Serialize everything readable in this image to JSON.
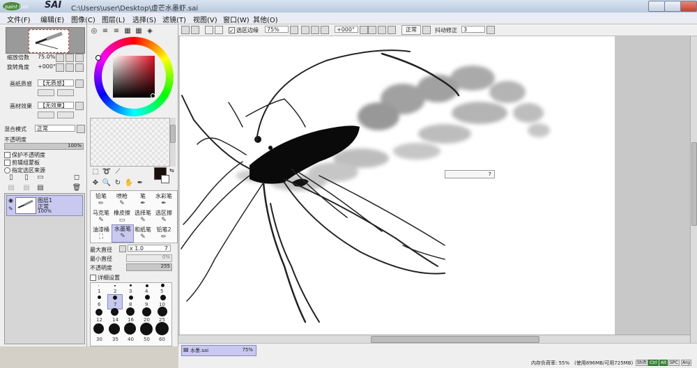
{
  "window": {
    "app_name": "SAI",
    "title": "C:\\Users\\user\\Desktop\\虚芒水墨虾.sai"
  },
  "menu": {
    "items": [
      "文件(F)",
      "编辑(E)",
      "图像(C)",
      "图层(L)",
      "选择(S)",
      "滤镜(T)",
      "视图(V)",
      "窗口(W)",
      "其他(O)"
    ]
  },
  "left_panel": {
    "zoom_label": "缩放倍数",
    "zoom_value": "75.0%",
    "angle_label": "旋转角度",
    "angle_value": "+000°",
    "paper_texture_label": "画纸质感",
    "paper_texture_value": "【无质感】",
    "material_effect_label": "画材效果",
    "material_effect_value": "【无效果】",
    "blend_mode_label": "混合模式",
    "blend_mode_value": "正常",
    "opacity_label": "不透明度",
    "opacity_value": "100%",
    "checkboxes": [
      "保护不透明度",
      "剪辑组蒙板",
      "指定选区来源"
    ],
    "layer": {
      "name": "图层1",
      "mode": "正常",
      "opacity": "100%"
    }
  },
  "tools": {
    "brushes": [
      "铅笔",
      "喷枪",
      "笔",
      "水彩笔",
      "马克笔",
      "橡皮擦",
      "选择笔",
      "选区擦",
      "油漆桶",
      "水墨笔",
      "和纸笔",
      "铅笔2"
    ],
    "max_diameter_label": "最大直径",
    "max_diameter_value": "x 1.0",
    "max_diameter_num": "7",
    "min_diameter_label": "最小直径",
    "min_diameter_value": "0%",
    "opacity_label": "不透明度",
    "opacity_value": "255",
    "detail_label": "详细设置",
    "size_rows": [
      [
        "1",
        "2",
        "3",
        "4",
        "5"
      ],
      [
        "6",
        "7",
        "8",
        "9",
        "10"
      ],
      [
        "12",
        "14",
        "16",
        "20",
        "25"
      ],
      [
        "30",
        "35",
        "40",
        "50",
        "60"
      ]
    ]
  },
  "toolbar": {
    "selection_edge_label": "选区边缘",
    "zoom_value": "75%",
    "angle_value": "+000°",
    "mode_button": "正常",
    "stabilizer_label": "抖动修正",
    "stabilizer_value": "3"
  },
  "canvas": {
    "overlay_value": "7"
  },
  "status": {
    "tab_name": "水墨.sai",
    "tab_zoom": "75%",
    "memory_label": "内存负荷率: 55%",
    "memory_detail": "(使用896MB/可用725MB)",
    "keys": [
      "Shift",
      "Ctrl",
      "Alt",
      "SPC",
      "Any"
    ]
  },
  "colors": {
    "window_chrome": "#d9e4f1",
    "panel": "#efefef",
    "canvas_bg": "#c8c8c8",
    "layer_selected": "#c8c8f0",
    "main_color": "#1a0e0e"
  }
}
